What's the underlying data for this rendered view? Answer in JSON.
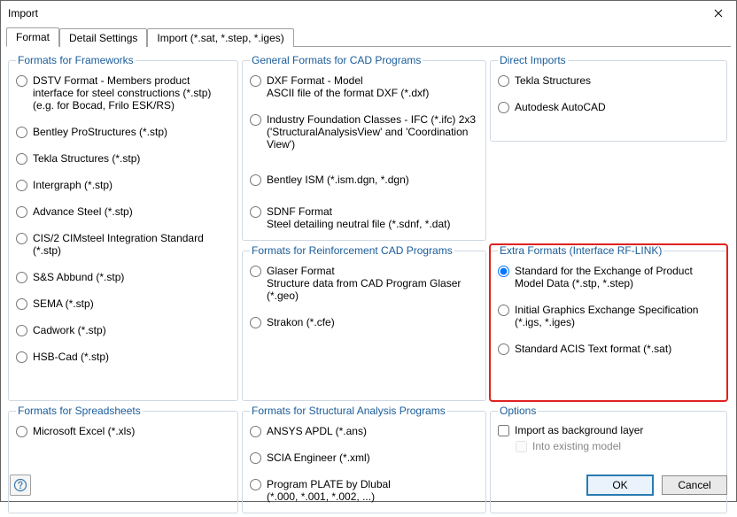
{
  "window": {
    "title": "Import"
  },
  "tabs": {
    "format": "Format",
    "detail": "Detail Settings",
    "import": "Import (*.sat, *.step, *.iges)"
  },
  "groups": {
    "frameworks": "Formats for Frameworks",
    "general_cad": "General Formats for CAD Programs",
    "reinforcement": "Formats for Reinforcement CAD Programs",
    "spreadsheets": "Formats for Spreadsheets",
    "structural": "Formats for Structural Analysis Programs",
    "direct": "Direct Imports",
    "extra": "Extra Formats (Interface RF-LINK)",
    "options": "Options"
  },
  "frameworks": {
    "dstv_main": "DSTV Format - Members product interface for steel constructions (*.stp)",
    "dstv_sub": "(e.g. for Bocad, Frilo ESK/RS)",
    "bentley_ps": "Bentley ProStructures (*.stp)",
    "tekla": "Tekla Structures (*.stp)",
    "intergraph": "Intergraph (*.stp)",
    "advance": "Advance Steel (*.stp)",
    "cis2": "CIS/2 CIMsteel Integration Standard (*.stp)",
    "ss_abbund": "S&S Abbund (*.stp)",
    "sema": "SEMA (*.stp)",
    "cadwork": "Cadwork (*.stp)",
    "hsb": "HSB-Cad (*.stp)"
  },
  "spreadsheets": {
    "excel": "Microsoft Excel (*.xls)"
  },
  "general_cad": {
    "dxf_main": "DXF Format - Model",
    "dxf_sub": "ASCII file of the format DXF (*.dxf)",
    "ifc_main": "Industry Foundation Classes - IFC (*.ifc) 2x3",
    "ifc_sub": "('StructuralAnalysisView' and 'Coordination View')",
    "bentley_ism": "Bentley ISM (*.ism.dgn, *.dgn)",
    "sdnf_main": "SDNF Format",
    "sdnf_sub": "Steel detailing neutral file (*.sdnf, *.dat)"
  },
  "reinforcement": {
    "glaser_main": "Glaser Format",
    "glaser_sub": "Structure data from CAD Program Glaser (*.geo)",
    "strakon": "Strakon (*.cfe)"
  },
  "structural": {
    "ansys": "ANSYS APDL (*.ans)",
    "scia": "SCIA Engineer (*.xml)",
    "plate_main": "Program PLATE by Dlubal",
    "plate_sub": "(*.000, *.001, *.002, ...)"
  },
  "direct": {
    "tekla": "Tekla Structures",
    "autocad": "Autodesk AutoCAD"
  },
  "extra": {
    "step_main": "Standard for the Exchange of Product Model Data (*.stp, *.step)",
    "iges_main": "Initial Graphics Exchange Specification (*.igs, *.iges)",
    "sat": "Standard ACIS Text format (*.sat)"
  },
  "options": {
    "bg_layer": "Import as background layer",
    "existing": "Into existing model"
  },
  "buttons": {
    "ok": "OK",
    "cancel": "Cancel"
  }
}
